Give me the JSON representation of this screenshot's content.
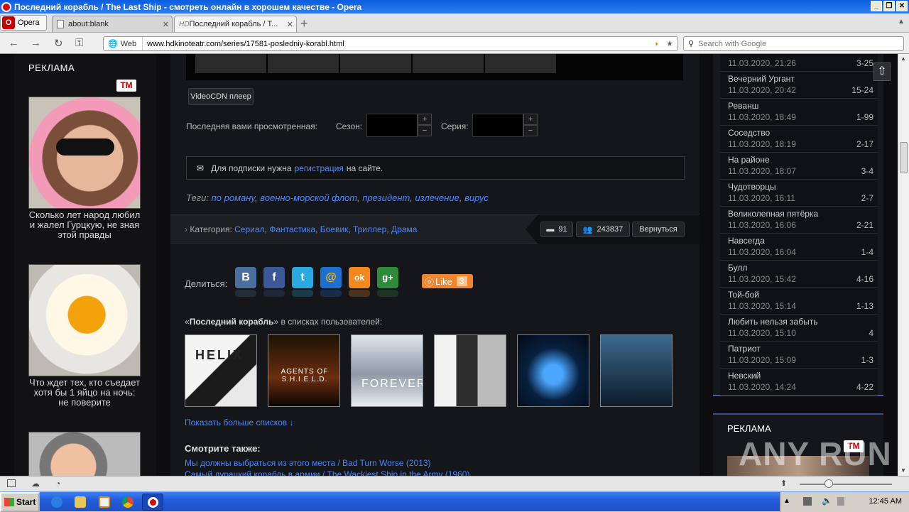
{
  "window": {
    "title": "Последний корабль / The Last Ship - смотреть онлайн в хорошем качестве - Opera"
  },
  "browser": {
    "menu_label": "Opera",
    "tabs": [
      {
        "label": "about:blank"
      },
      {
        "label": "Последний корабль / Т..."
      }
    ],
    "tab2_prefix": "HD",
    "web_label": "Web",
    "url": "www.hdkinoteatr.com/series/17581-posledniy-korabl.html",
    "search_placeholder": "Search with Google"
  },
  "left_ad": {
    "title": "РЕКЛАМА",
    "badge": "TM",
    "items": [
      {
        "caption": "Сколько лет народ любил и жалел Гурцкую, не зная этой правды"
      },
      {
        "caption": "Что ждет тех, кто съедает хотя бы 1 яйцо на ночь: не поверите"
      }
    ]
  },
  "main": {
    "videocdn_label": "VideoCDN плеер",
    "last_watched_label": "Последняя вами просмотренная:",
    "season_label": "Сезон:",
    "episode_label": "Серия:",
    "subscribe_text_before": "Для подписки нужна",
    "subscribe_link": "регистрация",
    "subscribe_text_after": "на сайте.",
    "tags_label": "Теги:",
    "tags": [
      "по роману",
      "военно-морской флот",
      "президент",
      "излечение",
      "вирус"
    ],
    "category_label": "Категория:",
    "categories": [
      "Сериал",
      "Фантастика",
      "Боевик",
      "Триллер",
      "Драма"
    ],
    "comments_count": "91",
    "views_count": "243837",
    "back_label": "Вернуться",
    "share_label": "Делиться:",
    "social": [
      "B",
      "f",
      "t",
      "@",
      "ok",
      "g+"
    ],
    "like_label": "Like",
    "like_count": "3",
    "lists_title_quote_open": "«",
    "lists_title_bold": "Последний корабль",
    "lists_title_rest": "» в списках пользователей:",
    "posters": [
      "HELIX",
      "AGENTS OF S.H.I.E.L.D.",
      "FOREVER",
      "",
      "",
      ""
    ],
    "more_lists": "Показать больше списков ↓",
    "see_also_title": "Смотрите также:",
    "see_also": [
      "Мы должны выбраться из этого места / Bad Turn Worse (2013)",
      "Самый дурацкий корабль в армии / The Wackiest Ship in the Army (1960)"
    ]
  },
  "updates": [
    {
      "title": "",
      "date": "11.03.2020, 21:26",
      "episodes": "3-25"
    },
    {
      "title": "Вечерний Ургант",
      "date": "11.03.2020, 20:42",
      "episodes": "15-24"
    },
    {
      "title": "Реванш",
      "date": "11.03.2020, 18:49",
      "episodes": "1-99"
    },
    {
      "title": "Соседство",
      "date": "11.03.2020, 18:19",
      "episodes": "2-17"
    },
    {
      "title": "На районе",
      "date": "11.03.2020, 18:07",
      "episodes": "3-4"
    },
    {
      "title": "Чудотворцы",
      "date": "11.03.2020, 16:11",
      "episodes": "2-7"
    },
    {
      "title": "Великолепная пятёрка",
      "date": "11.03.2020, 16:06",
      "episodes": "2-21"
    },
    {
      "title": "Навсегда",
      "date": "11.03.2020, 16:04",
      "episodes": "1-4"
    },
    {
      "title": "Булл",
      "date": "11.03.2020, 15:42",
      "episodes": "4-16"
    },
    {
      "title": "Той-бой",
      "date": "11.03.2020, 15:14",
      "episodes": "1-13"
    },
    {
      "title": "Любить нельзя забыть",
      "date": "11.03.2020, 15:10",
      "episodes": "4"
    },
    {
      "title": "Патриот",
      "date": "11.03.2020, 15:09",
      "episodes": "1-3"
    },
    {
      "title": "Невский",
      "date": "11.03.2020, 14:24",
      "episodes": "4-22"
    }
  ],
  "right_ad": {
    "title": "РЕКЛАМА",
    "badge": "TM"
  },
  "watermark": "ANY RUN",
  "taskbar": {
    "start_label": "Start",
    "clock": "12:45 AM"
  },
  "colors": {
    "link": "#4a87ff",
    "page_bg": "#0d0d0f",
    "accent_blue": "#3b5db8"
  }
}
